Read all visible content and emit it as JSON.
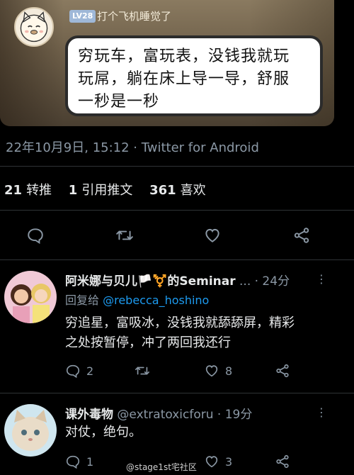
{
  "meme": {
    "level_badge": "LV28",
    "nickname": "打个飞机睡觉了",
    "bubble_lines": [
      "穷玩车，富玩表，没钱我就玩",
      "玩屌，躺在床上导一导，舒服",
      "一秒是一秒"
    ]
  },
  "tweet": {
    "timestamp": "22年10月9日, 15:12 · ",
    "source": "Twitter for Android",
    "stats": [
      {
        "count": "21",
        "label": "转推"
      },
      {
        "count": "1",
        "label": "引用推文"
      },
      {
        "count": "361",
        "label": "喜欢"
      }
    ]
  },
  "replies": [
    {
      "name": "阿米娜与贝儿🏳️⚧️的Seminar",
      "handle_suffix": " ... · 24分",
      "replying_prefix": "回复给 ",
      "replying_to": "@rebecca_hoshino",
      "text_lines": [
        "穷追星，富吸冰，没钱我就舔舔屏，精彩",
        "之处按暂停，冲了两回我还行"
      ],
      "reply_count": "2",
      "like_count": "8"
    },
    {
      "name": "课外毒物",
      "handle_suffix": " @extratoxicforu · 19分",
      "text_lines": [
        "对仗，绝句。"
      ],
      "reply_count": "1",
      "like_count": "3"
    }
  ],
  "more_icon": "⋮",
  "watermark": "@stage1st宅社区",
  "colors": {
    "background": "#000000",
    "link": "#1d9bf0",
    "muted": "#8b98a5"
  }
}
